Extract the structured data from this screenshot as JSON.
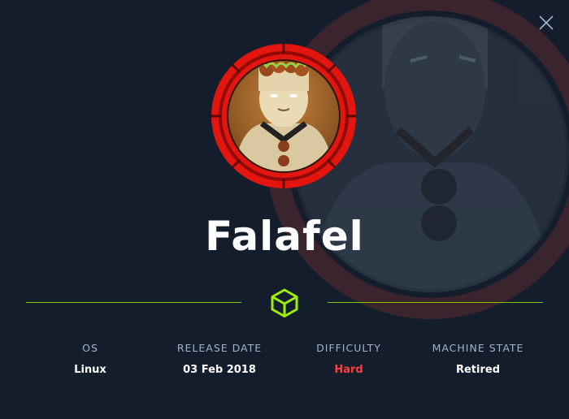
{
  "machine": {
    "name": "Falafel"
  },
  "stats": [
    {
      "label": "OS",
      "value": "Linux"
    },
    {
      "label": "RELEASE DATE",
      "value": "03 Feb 2018"
    },
    {
      "label": "DIFFICULTY",
      "value": "Hard"
    },
    {
      "label": "MACHINE STATE",
      "value": "Retired"
    }
  ],
  "colors": {
    "background": "#141d2b",
    "accent": "#9fef00",
    "difficulty_hard": "#ff3e3e",
    "label": "#a4b1cd",
    "ring": "#e3150f"
  },
  "icons": {
    "close": "close-icon",
    "divider": "cube-icon"
  }
}
